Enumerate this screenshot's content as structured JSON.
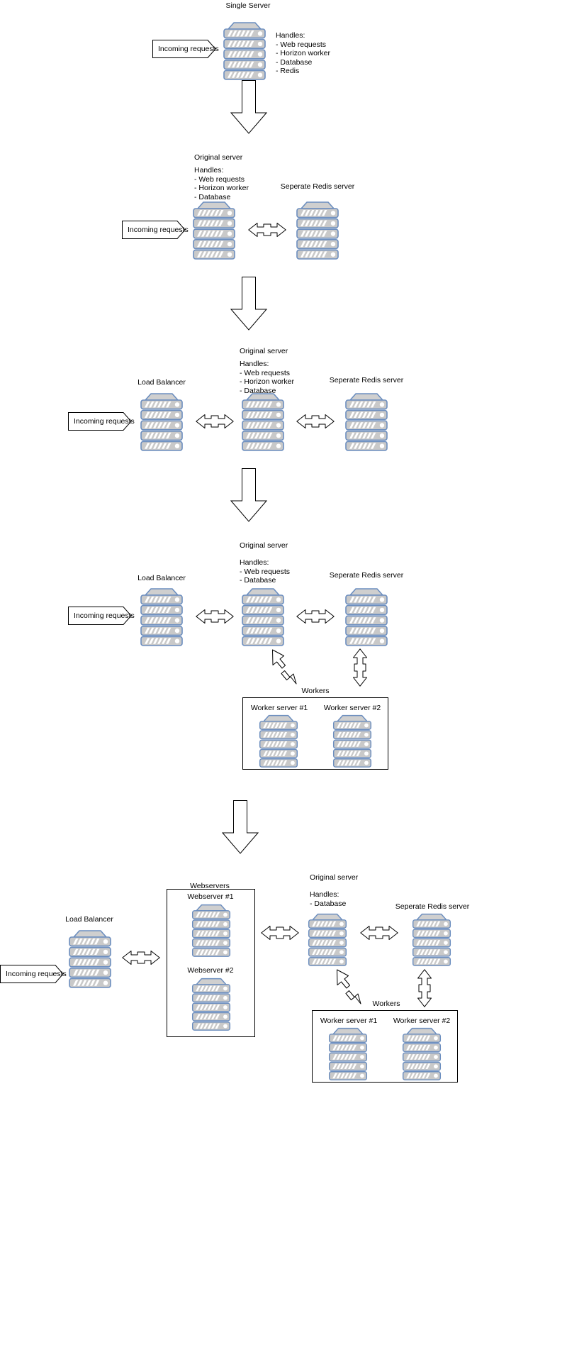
{
  "diagram": {
    "title": "Server scaling architecture evolution",
    "colors": {
      "server_border": "#6c8ebf",
      "server_body": "#c8c8c8",
      "server_top": "#cccccc",
      "outline": "#000000",
      "background": "#ffffff"
    },
    "incoming_requests_label": "Incoming requests",
    "handles_label": "Handles:"
  },
  "stages": [
    {
      "id": "stage-1",
      "title": "Single Server",
      "inputs": [
        "Incoming requests"
      ],
      "nodes": [
        {
          "id": "single-server",
          "label": "Single Server",
          "handles_title": "Handles:",
          "handles": [
            "- Web requests",
            "- Horizon worker",
            "- Database",
            "- Redis"
          ]
        }
      ]
    },
    {
      "id": "stage-2",
      "inputs": [
        "Incoming requests"
      ],
      "nodes": [
        {
          "id": "original-server",
          "label": "Original server",
          "handles_title": "Handles:",
          "handles": [
            "- Web requests",
            "- Horizon worker",
            "- Database"
          ]
        },
        {
          "id": "redis-server",
          "label": "Seperate Redis server",
          "handles": []
        }
      ]
    },
    {
      "id": "stage-3",
      "inputs": [
        "Incoming requests"
      ],
      "nodes": [
        {
          "id": "load-balancer",
          "label": "Load Balancer",
          "handles": []
        },
        {
          "id": "original-server",
          "label": "Original server",
          "handles_title": "Handles:",
          "handles": [
            "- Web requests",
            "- Horizon worker",
            "- Database"
          ]
        },
        {
          "id": "redis-server",
          "label": "Seperate Redis server",
          "handles": []
        }
      ]
    },
    {
      "id": "stage-4",
      "inputs": [
        "Incoming requests"
      ],
      "nodes": [
        {
          "id": "load-balancer",
          "label": "Load Balancer",
          "handles": []
        },
        {
          "id": "original-server",
          "label": "Original server",
          "handles_title": "Handles:",
          "handles": [
            "- Web requests",
            "- Database"
          ]
        },
        {
          "id": "redis-server",
          "label": "Seperate Redis server",
          "handles": []
        }
      ],
      "groups": [
        {
          "id": "workers",
          "label": "Workers",
          "members": [
            "Worker server #1",
            "Worker server #2"
          ]
        }
      ]
    },
    {
      "id": "stage-5",
      "inputs": [
        "Incoming requests"
      ],
      "nodes": [
        {
          "id": "load-balancer",
          "label": "Load Balancer",
          "handles": []
        },
        {
          "id": "original-server",
          "label": "Original server",
          "handles_title": "Handles:",
          "handles": [
            "- Database"
          ]
        },
        {
          "id": "redis-server",
          "label": "Seperate Redis server",
          "handles": []
        }
      ],
      "groups": [
        {
          "id": "webservers",
          "label": "Webservers",
          "members": [
            "Webserver #1",
            "Webserver #2"
          ]
        },
        {
          "id": "workers",
          "label": "Workers",
          "members": [
            "Worker server #1",
            "Worker server #2"
          ]
        }
      ]
    }
  ],
  "text": {
    "stage1_title": "Single Server",
    "stage1_handles": "Handles:\n- Web requests\n- Horizon worker\n- Database\n- Redis",
    "stage2_original_title": "Original server",
    "stage2_original_handles": "Handles:\n- Web requests\n- Horizon worker\n- Database",
    "stage2_redis_title": "Seperate Redis server",
    "stage3_lb_title": "Load Balancer",
    "stage3_original_title": "Original server",
    "stage3_original_handles": "Handles:\n- Web requests\n- Horizon worker\n- Database",
    "stage3_redis_title": "Seperate Redis server",
    "stage4_lb_title": "Load Balancer",
    "stage4_original_title": "Original server",
    "stage4_original_handles": "Handles:\n- Web requests\n- Database",
    "stage4_redis_title": "Seperate Redis server",
    "stage4_workers_title": "Workers",
    "stage4_worker1": "Worker server #1",
    "stage4_worker2": "Worker server #2",
    "stage5_lb_title": "Load Balancer",
    "stage5_webservers_title": "Webservers",
    "stage5_webserver1": "Webserver #1",
    "stage5_webserver2": "Webserver #2",
    "stage5_original_title": "Original server",
    "stage5_original_handles": "Handles:\n- Database",
    "stage5_redis_title": "Seperate Redis server",
    "stage5_workers_title": "Workers",
    "stage5_worker1": "Worker server #1",
    "stage5_worker2": "Worker server #2",
    "incoming_1": "Incoming requests",
    "incoming_2": "Incoming requests",
    "incoming_3": "Incoming requests",
    "incoming_4": "Incoming requests",
    "incoming_5": "Incoming requests"
  }
}
